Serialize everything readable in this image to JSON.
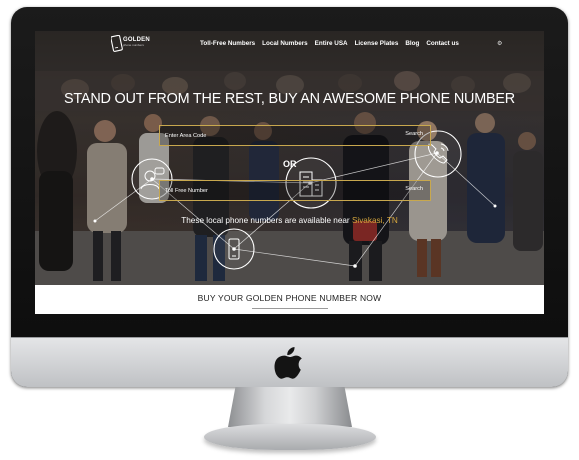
{
  "brand": {
    "name": "GOLDEN",
    "tagline": "phone numbers"
  },
  "nav": {
    "items": [
      {
        "label": "Toll-Free Numbers"
      },
      {
        "label": "Local Numbers"
      },
      {
        "label": "Entire USA"
      },
      {
        "label": "License Plates"
      },
      {
        "label": "Blog"
      },
      {
        "label": "Contact us"
      }
    ]
  },
  "hero": {
    "headline": "STAND OUT FROM THE REST, BUY AN AWESOME PHONE NUMBER",
    "search_area": {
      "placeholder": "Enter Area Code",
      "button_label": "Search"
    },
    "or_label": "OR",
    "search_tollfree": {
      "placeholder": "Toll Free Number",
      "button_label": "Search"
    },
    "available_prefix": "These local phone numbers are available near ",
    "available_location": "Sivakasi, TN"
  },
  "cta": {
    "label": "BUY YOUR GOLDEN PHONE NUMBER NOW"
  },
  "colors": {
    "accent_gold": "#d6a73d",
    "border_gold": "#c8a84e",
    "bezel": "#111111",
    "chin": "#d9dadc"
  },
  "icons": [
    "apple-logo-icon",
    "phone-ring-icon",
    "buildings-icon",
    "user-chat-icon",
    "smartphone-icon",
    "settings-icon"
  ]
}
